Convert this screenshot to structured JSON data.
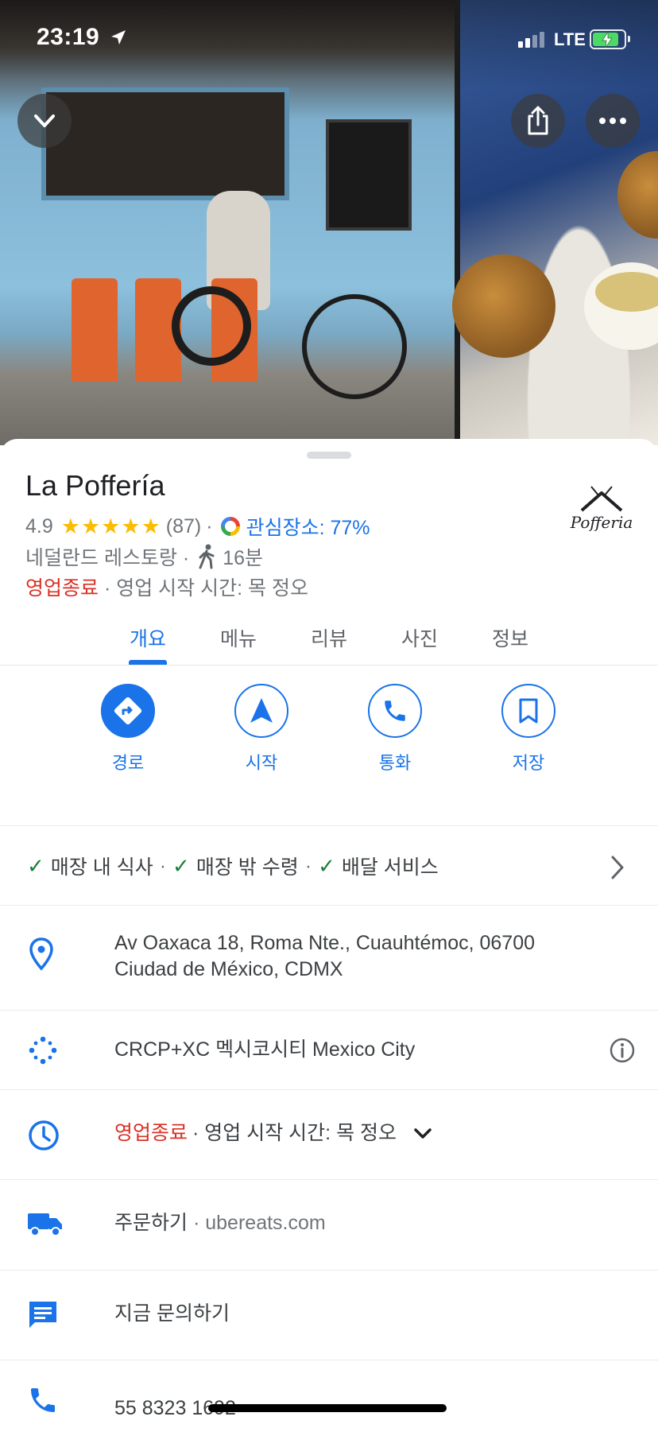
{
  "status_bar": {
    "time": "23:19",
    "network": "LTE"
  },
  "place": {
    "name": "La Poffería",
    "rating": "4.9",
    "stars": "★★★★★",
    "review_count": "(87)",
    "dot": "·",
    "interest": "관심장소: 77%",
    "category": "네덜란드 레스토랑 ·",
    "walk_time": "16분",
    "status_closed": "영업종료",
    "hours_note": "· 영업 시작 시간: 목 정오",
    "logo_text": "Pofferia"
  },
  "tabs": [
    {
      "label": "개요"
    },
    {
      "label": "메뉴"
    },
    {
      "label": "리뷰"
    },
    {
      "label": "사진"
    },
    {
      "label": "정보"
    }
  ],
  "actions": [
    {
      "label": "경로",
      "icon": "directions-icon"
    },
    {
      "label": "시작",
      "icon": "navigation-icon"
    },
    {
      "label": "통화",
      "icon": "phone-icon"
    },
    {
      "label": "저장",
      "icon": "bookmark-icon"
    }
  ],
  "services": {
    "dine_in": "매장 내 식사",
    "takeout": "매장 밖 수령",
    "delivery": "배달 서비스",
    "separator": "·"
  },
  "details": {
    "address_line1": "Av Oaxaca 18, Roma Nte., Cuauhtémoc, 06700",
    "address_line2": "Ciudad de México, CDMX",
    "plus_code": "CRCP+XC 멕시코시티 Mexico City",
    "hours_closed": "영업종료",
    "hours_note": "· 영업 시작 시간: 목 정오",
    "order_label": "주문하기",
    "order_sep": "·",
    "order_site": "ubereats.com",
    "chat": "지금 문의하기",
    "phone": "55 8323 1692"
  },
  "colors": {
    "accent": "#1a73e8",
    "closed": "#d93025",
    "star": "#fbbc04",
    "check": "#188038"
  }
}
